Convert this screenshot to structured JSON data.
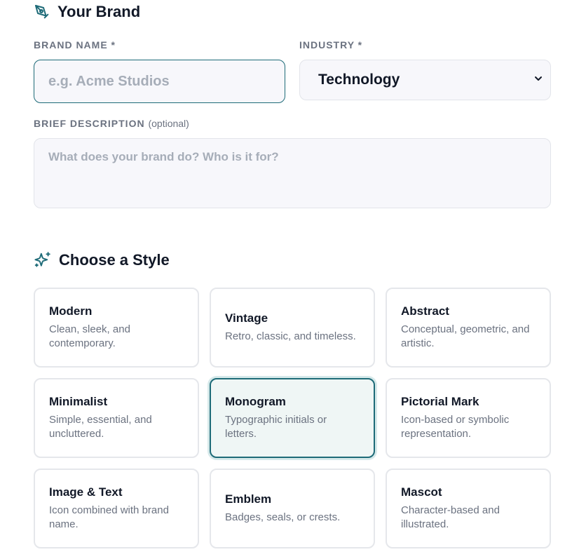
{
  "brand_section": {
    "title": "Your Brand",
    "icon": "pen-nib-icon",
    "brand_name_label": "BRAND NAME *",
    "brand_name_placeholder": "e.g. Acme Studios",
    "brand_name_value": "",
    "industry_label": "INDUSTRY *",
    "industry_value": "Technology",
    "description_label": "BRIEF DESCRIPTION",
    "description_optional": "(optional)",
    "description_placeholder": "What does your brand do? Who is it for?",
    "description_value": ""
  },
  "style_section": {
    "title": "Choose a Style",
    "icon": "sparkles-icon",
    "selected": "Monogram",
    "styles": [
      {
        "name": "Modern",
        "desc": "Clean, sleek, and contemporary."
      },
      {
        "name": "Vintage",
        "desc": "Retro, classic, and timeless."
      },
      {
        "name": "Abstract",
        "desc": "Conceptual, geometric, and artistic."
      },
      {
        "name": "Minimalist",
        "desc": "Simple, essential, and uncluttered."
      },
      {
        "name": "Monogram",
        "desc": "Typographic initials or letters."
      },
      {
        "name": "Pictorial Mark",
        "desc": "Icon-based or symbolic representation."
      },
      {
        "name": "Image & Text",
        "desc": "Icon combined with brand name."
      },
      {
        "name": "Emblem",
        "desc": "Badges, seals, or crests."
      },
      {
        "name": "Mascot",
        "desc": "Character-based and illustrated."
      }
    ]
  },
  "colors": {
    "accent": "#1e6b78",
    "selected_bg": "#eff6f5",
    "muted_text": "#6b7280"
  }
}
